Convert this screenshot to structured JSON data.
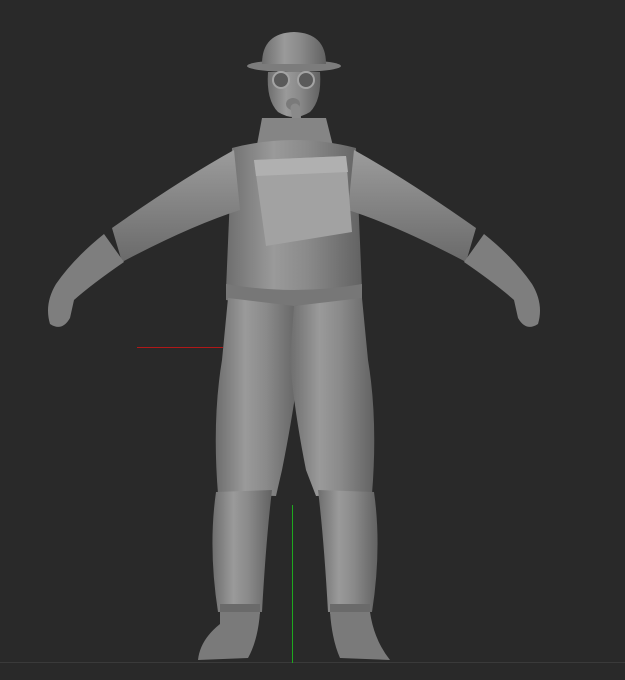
{
  "viewport": {
    "background": "#292929",
    "axis_colors": {
      "x_axis": "#b01818",
      "y_axis": "#1ea81e"
    }
  },
  "model": {
    "subject": "gas-mask-soldier-sculpt",
    "material_color": "#8e8e8e",
    "pose": "t-pose"
  }
}
